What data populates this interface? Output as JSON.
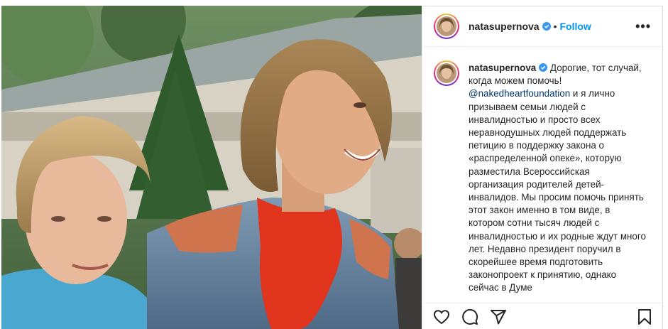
{
  "post": {
    "author": "natasupernova",
    "follow_label": "Follow",
    "separator": "•",
    "more_label": "•••",
    "caption_parts": {
      "before_mention": "Дорогие, тот случай, когда можем помочь! ",
      "mention": "@nakedheartfoundation",
      "after_mention": " и я лично призываем семьи людей с инвалидностью и просто всех неравнодушных людей поддержать петицию в поддержку закона о «распределенной опеке», которую разместила Всероссийская организация родителей детей-инвалидов. Мы просим помочь принять этот закон именно в том виде, в котором сотни тысяч людей с инвалидностью и их родные ждут много лет. Недавно президент поручил в скорейшее время подготовить законопроект к принятию, однако сейчас в Думе"
    }
  },
  "icons": {
    "verified": "verified-badge-icon",
    "like": "heart-icon",
    "comment": "comment-icon",
    "share": "share-icon",
    "save": "bookmark-icon",
    "more": "more-options-icon"
  },
  "colors": {
    "follow": "#0095f6",
    "mention": "#00376b",
    "verified": "#3897f0",
    "text": "#262626"
  }
}
